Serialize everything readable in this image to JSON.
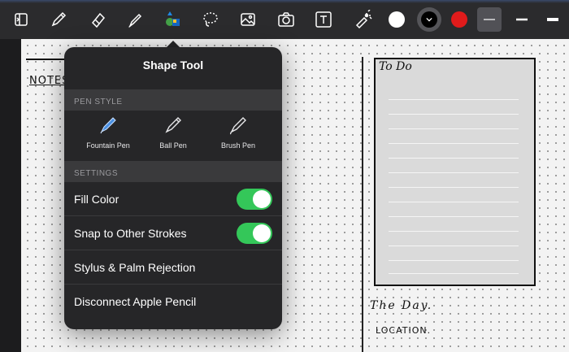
{
  "toolbar": {
    "tools": [
      "sidebar-toggle",
      "pen",
      "eraser",
      "highlighter",
      "shape",
      "lasso",
      "image",
      "camera",
      "text-box",
      "laser-pointer"
    ],
    "colors": {
      "white": "#ffffff",
      "black": "#000000",
      "red": "#e01b1b",
      "accent": "#34c759"
    }
  },
  "canvas": {
    "notes_label": "NOTES",
    "todo_title": "To Do",
    "day_label": "The Day.",
    "location_label": "LOCATION."
  },
  "popover": {
    "title": "Shape Tool",
    "pen_style_header": "PEN STYLE",
    "pens": [
      "Fountain Pen",
      "Ball Pen",
      "Brush Pen"
    ],
    "settings_header": "SETTINGS",
    "settings": [
      {
        "label": "Fill Color",
        "toggle": true
      },
      {
        "label": "Snap to Other Strokes",
        "toggle": true
      },
      {
        "label": "Stylus & Palm Rejection"
      },
      {
        "label": "Disconnect Apple Pencil"
      }
    ]
  }
}
